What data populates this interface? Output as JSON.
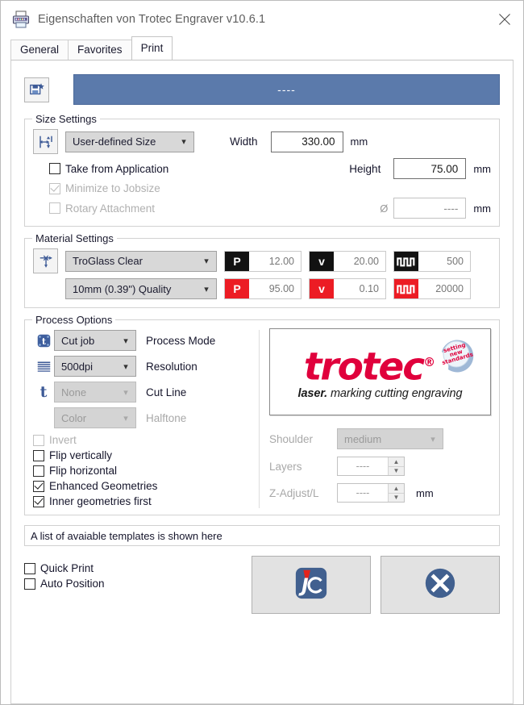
{
  "window": {
    "title": "Eigenschaften von Trotec Engraver v10.6.1",
    "title_icon": "printer-icon",
    "close_icon": "close-icon"
  },
  "tabs": [
    {
      "label": "General",
      "active": false
    },
    {
      "label": "Favorites",
      "active": false
    },
    {
      "label": "Print",
      "active": true
    }
  ],
  "header": {
    "save_icon": "save-favorite-icon",
    "banner_text": "----",
    "banner_color": "#5b7aab"
  },
  "size_settings": {
    "legend": "Size Settings",
    "icon": "size-settings-icon",
    "size_mode": "User-defined Size",
    "take_from_application": {
      "label": "Take from Application",
      "checked": false,
      "disabled": false
    },
    "minimize_to_jobsize": {
      "label": "Minimize to Jobsize",
      "checked": true,
      "disabled": true
    },
    "rotary_attachment": {
      "label": "Rotary Attachment",
      "checked": false,
      "disabled": true
    },
    "width": {
      "label": "Width",
      "value": "330.00",
      "unit": "mm"
    },
    "height": {
      "label": "Height",
      "value": "75.00",
      "unit": "mm"
    },
    "diameter": {
      "symbol": "Ø",
      "value": "----",
      "unit": "mm"
    }
  },
  "material_settings": {
    "legend": "Material Settings",
    "icon": "material-settings-icon",
    "material": "TroGlass Clear",
    "thickness": "10mm (0.39\") Quality",
    "rows": [
      {
        "badge_color": "#121212",
        "params": [
          {
            "badge": "P",
            "value": "12.00"
          },
          {
            "badge": "v",
            "value": "20.00"
          },
          {
            "badge": "frequency-icon",
            "value": "500"
          }
        ]
      },
      {
        "badge_color": "#ec1c24",
        "params": [
          {
            "badge": "P",
            "value": "95.00"
          },
          {
            "badge": "v",
            "value": "0.10"
          },
          {
            "badge": "frequency-icon",
            "value": "20000"
          }
        ]
      }
    ]
  },
  "process_options": {
    "legend": "Process Options",
    "process_mode": {
      "label": "Process Mode",
      "value": "Cut job",
      "icon": "job-type-icon",
      "disabled": false
    },
    "resolution": {
      "label": "Resolution",
      "value": "500dpi",
      "icon": "resolution-lines-icon",
      "disabled": false
    },
    "cut_line": {
      "label": "Cut Line",
      "value": "None",
      "icon": "cutline-t-icon",
      "disabled": true
    },
    "halftone": {
      "label": "Halftone",
      "value": "Color",
      "disabled": true
    },
    "checkboxes": [
      {
        "label": "Invert",
        "checked": false,
        "disabled": true
      },
      {
        "label": "Flip vertically",
        "checked": false,
        "disabled": false
      },
      {
        "label": "Flip horizontal",
        "checked": false,
        "disabled": false
      },
      {
        "label": "Enhanced Geometries",
        "checked": true,
        "disabled": false
      },
      {
        "label": "Inner geometries first",
        "checked": true,
        "disabled": false
      }
    ],
    "logo": {
      "word": "trotec",
      "registered": "®",
      "tagline_bold": "laser.",
      "tagline": " marking cutting engraving",
      "badge_text": "setting new standards",
      "color": "#e0003c"
    },
    "shoulder": {
      "label": "Shoulder",
      "value": "medium",
      "disabled": true
    },
    "layers": {
      "label": "Layers",
      "value": "----",
      "disabled": true
    },
    "z_adjust": {
      "label": "Z-Adjust/L",
      "value": "----",
      "unit": "mm",
      "disabled": true
    }
  },
  "templates": {
    "text": "A list of avaiable templates is shown here"
  },
  "bottom": {
    "quick_print": {
      "label": "Quick Print",
      "checked": false
    },
    "auto_position": {
      "label": "Auto Position",
      "checked": false
    },
    "jobcontrol_button": {
      "icon": "jobcontrol-icon",
      "label": "JC"
    },
    "cancel_button": {
      "icon": "cancel-x-icon"
    }
  }
}
